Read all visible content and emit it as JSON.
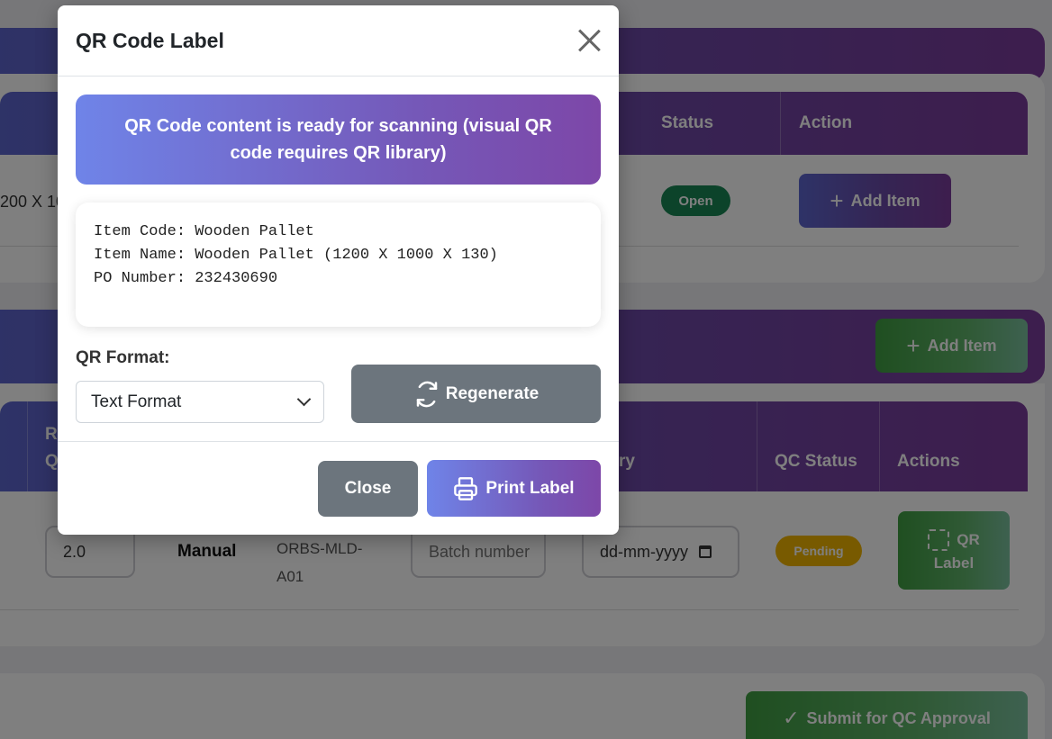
{
  "background": {
    "table1": {
      "headers": {
        "status": "Status",
        "action": "Action"
      },
      "row": {
        "item_fragment": "200 X 10",
        "status_badge": "Open",
        "add_item_label": "Add Item"
      }
    },
    "section2": {
      "add_item_label": "Add Item"
    },
    "table2": {
      "headers": {
        "partial_r": "R",
        "partial_q": "Q",
        "partial_ry": "ry",
        "qc_status": "QC Status",
        "actions": "Actions"
      },
      "row": {
        "quantity": "2.0",
        "type": "Manual",
        "location_line1": "ORBS-MLD-",
        "location_line2": "A01",
        "batch_placeholder": "Batch number",
        "date_placeholder": "dd-mm-yyyy",
        "qc_status_badge": "Pending",
        "qr_label_line1": "QR",
        "qr_label_line2": "Label"
      }
    },
    "submit_label": "Submit for QC Approval"
  },
  "modal": {
    "title": "QR Code Label",
    "alert_text": "QR Code content is ready for scanning (visual QR code requires QR library)",
    "content_lines": [
      "Item Code: Wooden Pallet",
      "Item Name: Wooden Pallet (1200 X 1000 X 130)",
      "PO Number: 232430690"
    ],
    "format_label": "QR Format:",
    "format_selected": "Text Format",
    "regenerate_label": "Regenerate",
    "close_label": "Close",
    "print_label": "Print Label"
  },
  "colors": {
    "primary_gradient_start": "#6f84e8",
    "primary_gradient_end": "#7d47a8",
    "secondary": "#6c757d",
    "success": "#3f9e42",
    "status_open": "#198754",
    "status_pending": "#f0b400"
  },
  "icons": {
    "close": "close-icon",
    "regenerate": "refresh-icon",
    "print": "printer-icon",
    "add": "plus-icon",
    "qr": "qr-scan-icon",
    "submit": "check-icon",
    "calendar": "calendar-icon",
    "select": "chevron-down-icon"
  }
}
